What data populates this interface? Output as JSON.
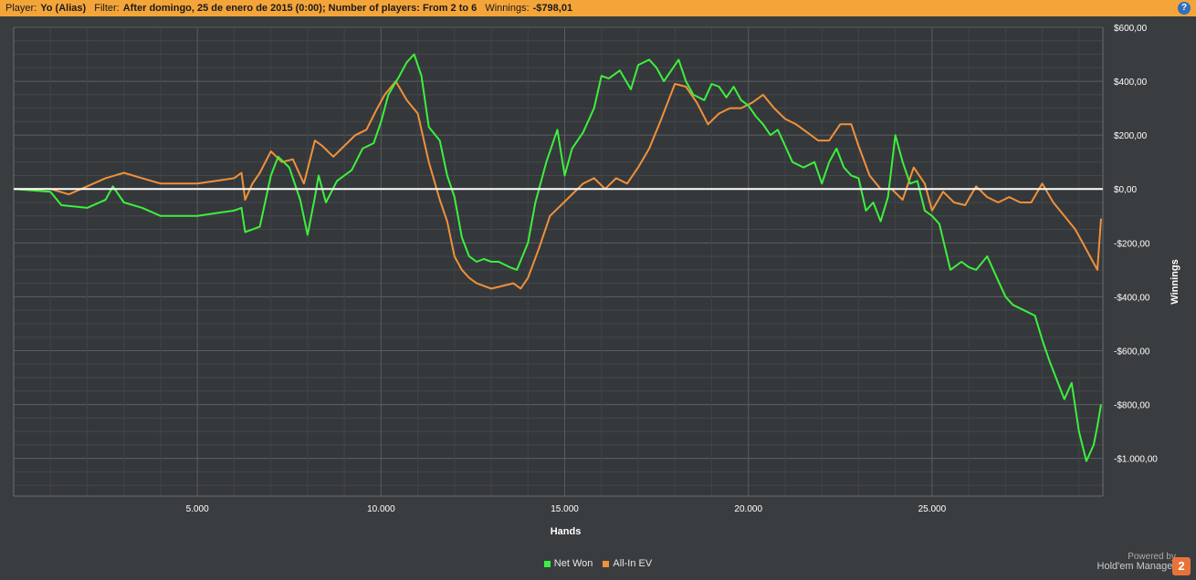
{
  "header": {
    "player_label": "Player:",
    "player_value": "Yo (Alias)",
    "filter_label": "Filter:",
    "filter_value": "After domingo, 25 de enero de 2015 (0:00); Number of players: From 2 to 6",
    "winnings_label": "Winnings:",
    "winnings_value": "-$798,01",
    "help_glyph": "?"
  },
  "footer": {
    "powered_by": "Powered by",
    "brand_name": "Hold'em Manager",
    "brand_badge": "2"
  },
  "colors": {
    "background": "#3a3d40",
    "header": "#f4a53a",
    "net_won": "#3cf03c",
    "all_in_ev": "#f0913a",
    "zero_line": "#ffffff",
    "grid": "#5a5d60"
  },
  "chart_data": {
    "type": "line",
    "xlabel": "Hands",
    "ylabel": "Winnings",
    "xlim": [
      0,
      29650
    ],
    "ylim": [
      -1140,
      600
    ],
    "x_ticks": [
      5000,
      10000,
      15000,
      20000,
      25000
    ],
    "x_tick_labels": [
      "5.000",
      "10.000",
      "15.000",
      "20.000",
      "25.000"
    ],
    "y_ticks": [
      600,
      400,
      200,
      0,
      -200,
      -400,
      -600,
      -800,
      -1000
    ],
    "y_tick_labels": [
      "$600,00",
      "$400,00",
      "$200,00",
      "$0,00",
      "-$200,00",
      "-$400,00",
      "-$600,00",
      "-$800,00",
      "-$1.000,00"
    ],
    "grid": true,
    "legend_position": "bottom-center",
    "series": [
      {
        "name": "Net Won",
        "x": [
          0,
          1000,
          1300,
          2000,
          2500,
          2700,
          3000,
          3500,
          4000,
          4500,
          5000,
          5500,
          6000,
          6200,
          6300,
          6500,
          6700,
          7000,
          7200,
          7500,
          7800,
          8000,
          8200,
          8300,
          8500,
          8800,
          9000,
          9200,
          9500,
          9800,
          10000,
          10200,
          10500,
          10700,
          10900,
          11100,
          11300,
          11600,
          11800,
          12000,
          12200,
          12400,
          12600,
          12800,
          13000,
          13200,
          13500,
          13700,
          14000,
          14200,
          14500,
          14800,
          15000,
          15200,
          15500,
          15800,
          16000,
          16200,
          16500,
          16800,
          17000,
          17300,
          17500,
          17700,
          17900,
          18100,
          18300,
          18500,
          18800,
          19000,
          19200,
          19400,
          19600,
          19800,
          20000,
          20200,
          20400,
          20600,
          20800,
          21000,
          21200,
          21500,
          21800,
          22000,
          22200,
          22400,
          22600,
          22800,
          23000,
          23200,
          23400,
          23600,
          23800,
          24000,
          24200,
          24400,
          24600,
          24800,
          25000,
          25200,
          25500,
          25800,
          26000,
          26200,
          26500,
          26800,
          27000,
          27200,
          27500,
          27800,
          28000,
          28200,
          28400,
          28600,
          28800,
          29000,
          29200,
          29400,
          29500,
          29600
        ],
        "y": [
          0,
          -10,
          -60,
          -70,
          -40,
          10,
          -50,
          -70,
          -100,
          -100,
          -100,
          -90,
          -80,
          -70,
          -160,
          -150,
          -140,
          50,
          120,
          80,
          -40,
          -170,
          -30,
          50,
          -50,
          30,
          50,
          70,
          150,
          170,
          250,
          350,
          420,
          470,
          500,
          420,
          230,
          180,
          50,
          -30,
          -180,
          -250,
          -270,
          -260,
          -270,
          -270,
          -290,
          -300,
          -200,
          -50,
          100,
          220,
          50,
          150,
          210,
          300,
          420,
          410,
          440,
          370,
          460,
          480,
          450,
          400,
          440,
          480,
          400,
          350,
          330,
          390,
          380,
          340,
          380,
          330,
          310,
          270,
          240,
          200,
          220,
          160,
          100,
          80,
          100,
          20,
          100,
          150,
          80,
          50,
          40,
          -80,
          -50,
          -120,
          -30,
          200,
          100,
          20,
          30,
          -80,
          -100,
          -130,
          -300,
          -270,
          -290,
          -300,
          -250,
          -340,
          -400,
          -430,
          -450,
          -470,
          -560,
          -640,
          -710,
          -780,
          -720,
          -900,
          -1010,
          -950,
          -880,
          -800
        ]
      },
      {
        "name": "All-In EV",
        "x": [
          0,
          1000,
          1500,
          2000,
          2500,
          3000,
          3500,
          4000,
          4500,
          5000,
          5500,
          6000,
          6200,
          6300,
          6500,
          6700,
          7000,
          7300,
          7600,
          7900,
          8200,
          8400,
          8700,
          9000,
          9300,
          9600,
          9900,
          10100,
          10400,
          10700,
          11000,
          11300,
          11600,
          11800,
          12000,
          12200,
          12400,
          12600,
          12800,
          13000,
          13300,
          13600,
          13800,
          14000,
          14300,
          14600,
          14900,
          15200,
          15500,
          15800,
          16100,
          16400,
          16700,
          17000,
          17300,
          17600,
          17800,
          18000,
          18300,
          18600,
          18900,
          19200,
          19500,
          19800,
          20100,
          20400,
          20700,
          21000,
          21300,
          21600,
          21900,
          22200,
          22500,
          22800,
          23000,
          23300,
          23600,
          23900,
          24200,
          24500,
          24800,
          25000,
          25300,
          25600,
          25900,
          26200,
          26500,
          26800,
          27100,
          27400,
          27700,
          28000,
          28300,
          28600,
          28900,
          29100,
          29300,
          29500,
          29600
        ],
        "y": [
          0,
          0,
          -20,
          10,
          40,
          60,
          40,
          20,
          20,
          20,
          30,
          40,
          60,
          -40,
          20,
          60,
          140,
          100,
          110,
          20,
          180,
          160,
          120,
          160,
          200,
          220,
          300,
          350,
          400,
          330,
          280,
          100,
          -40,
          -120,
          -250,
          -300,
          -330,
          -350,
          -360,
          -370,
          -360,
          -350,
          -370,
          -330,
          -220,
          -100,
          -60,
          -20,
          20,
          40,
          0,
          40,
          20,
          80,
          150,
          250,
          320,
          390,
          380,
          320,
          240,
          280,
          300,
          300,
          320,
          350,
          300,
          260,
          240,
          210,
          180,
          180,
          240,
          240,
          160,
          50,
          0,
          0,
          -40,
          80,
          20,
          -80,
          -10,
          -50,
          -60,
          10,
          -30,
          -50,
          -30,
          -50,
          -50,
          20,
          -50,
          -100,
          -150,
          -200,
          -250,
          -300,
          -110
        ]
      }
    ]
  }
}
